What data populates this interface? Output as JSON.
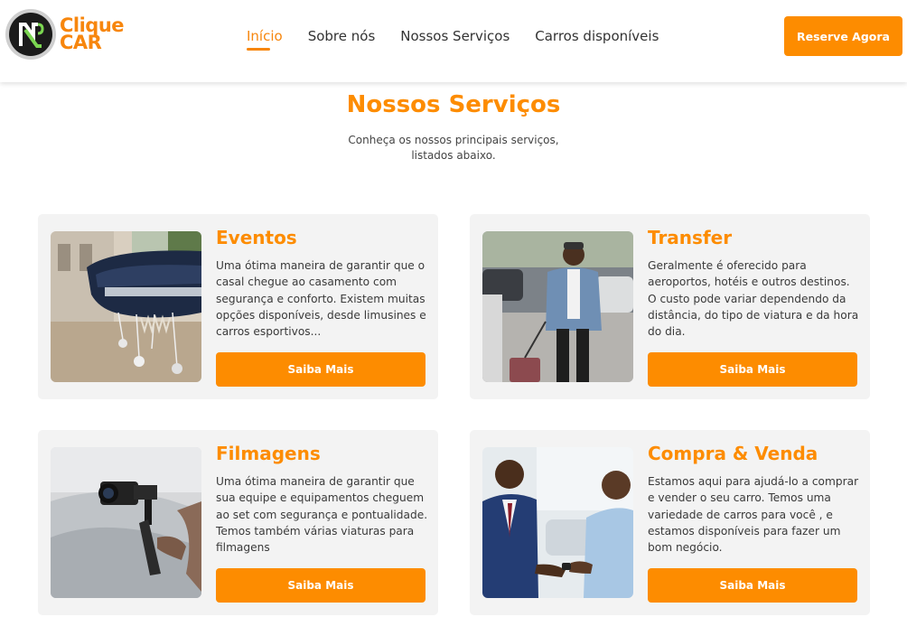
{
  "brand": {
    "line1": "Clique",
    "line2": "CAR",
    "accent": "#fd8c00"
  },
  "nav": {
    "items": [
      {
        "label": "Início",
        "active": true
      },
      {
        "label": "Sobre nós",
        "active": false
      },
      {
        "label": "Nossos Serviços",
        "active": false
      },
      {
        "label": "Carros disponíveis",
        "active": false
      }
    ],
    "cta": "Reserve Agora"
  },
  "section": {
    "title": "Nossos Serviços",
    "subtitle_line1": "Conheça os nossos principais serviços,",
    "subtitle_line2": "listados abaixo."
  },
  "cards": [
    {
      "title": "Eventos",
      "desc": "Uma ótima maneira de garantir que o casal chegue ao casamento com segurança e conforto. Existem muitas opções disponíveis, desde limusines e carros esportivos...",
      "button": "Saiba Mais",
      "image": "wedding-car-photo"
    },
    {
      "title": "Transfer",
      "desc": "Geralmente é oferecido para aeroportos, hotéis e outros destinos. O custo pode variar dependendo da distância, do tipo de viatura e da hora do dia.",
      "button": "Saiba Mais",
      "image": "traveler-with-suitcase-photo"
    },
    {
      "title": "Filmagens",
      "desc": "Uma ótima maneira de garantir que sua equipe e equipamentos cheguem ao set com segurança e pontualidade. Temos também várias viaturas para filmagens",
      "button": "Saiba Mais",
      "image": "camera-gimbal-photo"
    },
    {
      "title": "Compra & Venda",
      "desc": "Estamos aqui para ajudá-lo a comprar e vender o seu carro. Temos uma variedade de carros para você , e estamos disponíveis para fazer um bom negócio.",
      "button": "Saiba Mais",
      "image": "car-key-handover-photo"
    }
  ]
}
